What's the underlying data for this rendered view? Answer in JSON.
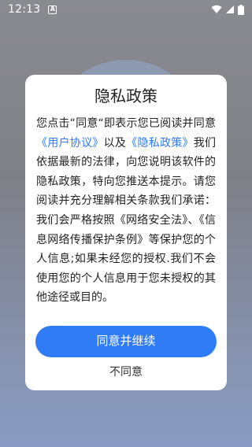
{
  "status_bar": {
    "time": "12:13",
    "notification_icon": "a-icon",
    "wifi_icon": "wifi-icon",
    "signal_icon": "cellular-signal-icon",
    "battery_icon": "battery-icon"
  },
  "dialog": {
    "title": "隐私政策",
    "body_1": "您点击“同意“即表示您已阅读并同意",
    "link_user_agreement": "《用户协议》",
    "body_2": "以及",
    "link_privacy_policy": "《隐私政策》",
    "body_3": "我们依据最新的法律，向您说明该软件的隐私政策，特向您推送本提示。请您阅读并充分理解相关条款我们承诺：我们会严格按照《网络安全法》、《信息网络传播保护条例》等保护您的个人信息;如果未经您的授权.我们不会使用您的个人信息用于您未授权的其他途径或目的。",
    "agree_label": "同意并继续",
    "decline_label": "不同意"
  },
  "colors": {
    "accent": "#2f7cf6",
    "text": "#222222",
    "overlay": "#7e8087"
  }
}
